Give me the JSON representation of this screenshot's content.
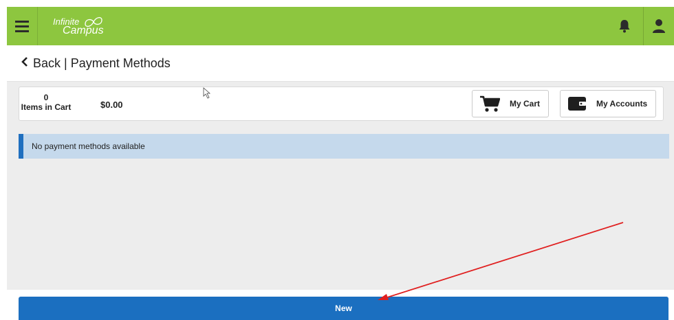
{
  "header": {
    "menu_icon": "hamburger-menu-icon",
    "logo_line1": "Infinite",
    "logo_line2": "Campus",
    "notification_icon": "bell-icon",
    "user_icon": "user-icon",
    "bar_color": "#8dc63f"
  },
  "page": {
    "back_icon": "chevron-left-icon",
    "title": "Back | Payment Methods"
  },
  "cart": {
    "item_count": "0",
    "items_label": "Items in Cart",
    "total": "$0.00",
    "my_cart_label": "My Cart",
    "my_cart_icon": "shopping-cart-icon",
    "my_accounts_label": "My Accounts",
    "my_accounts_icon": "wallet-icon"
  },
  "alert": {
    "message": "No payment methods available",
    "accent_color": "#1f6fbf"
  },
  "actions": {
    "new_label": "New",
    "button_color": "#1b6fc0"
  },
  "annotation": {
    "arrow_color": "#e02020"
  }
}
